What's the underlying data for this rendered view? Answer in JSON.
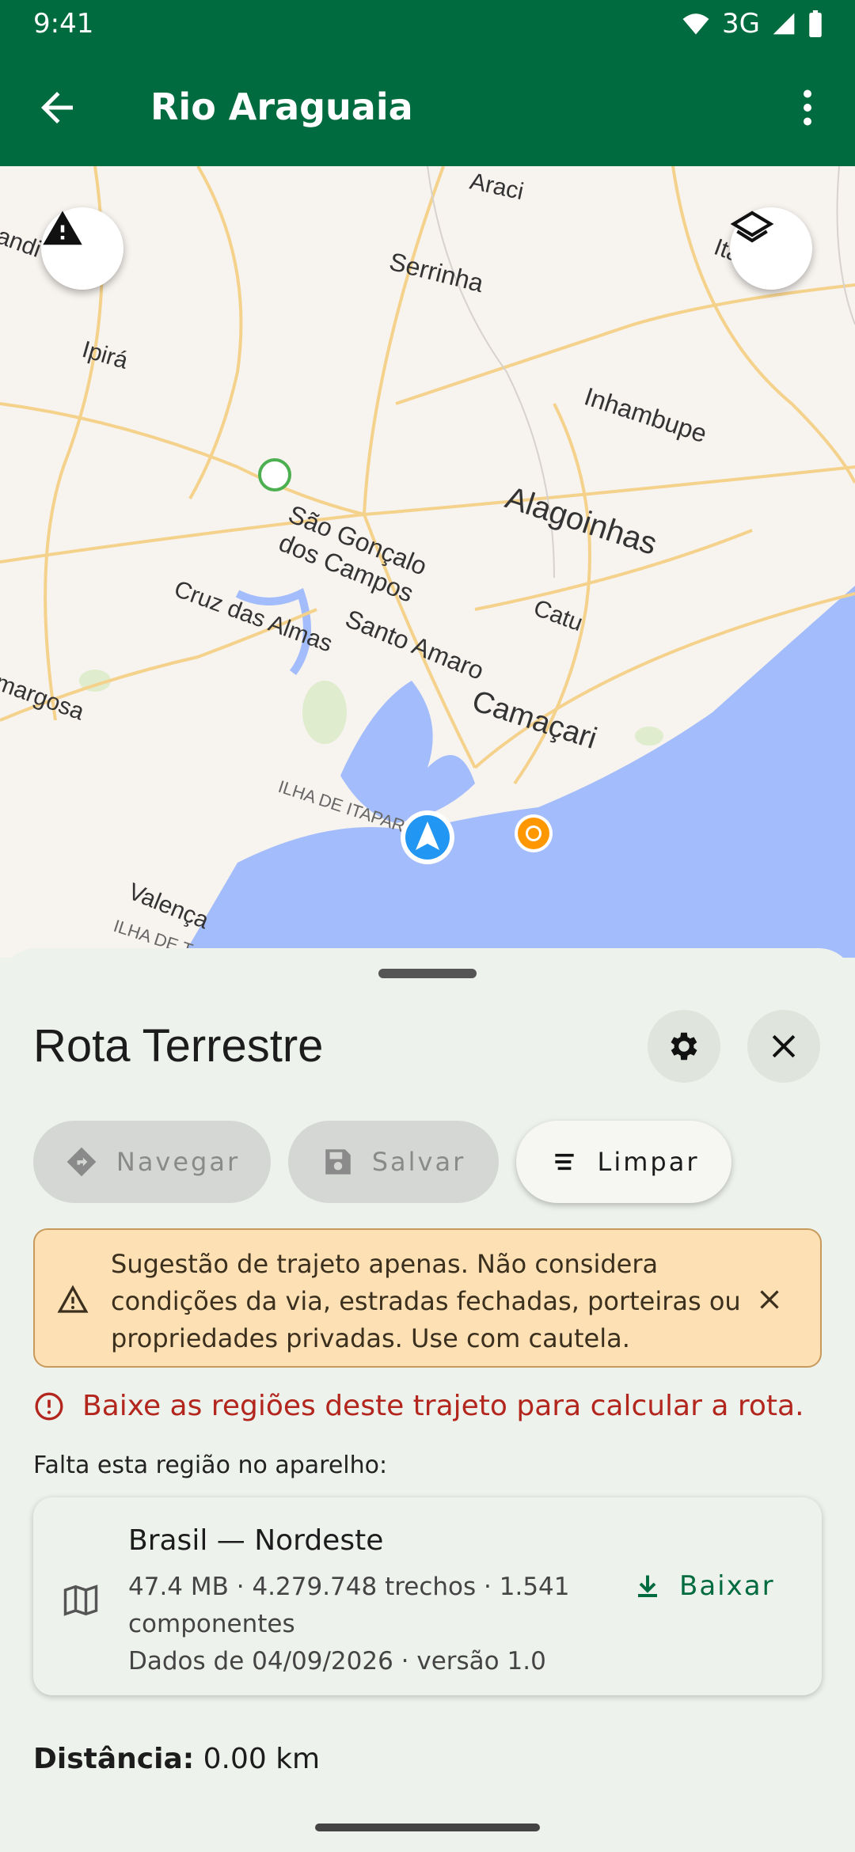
{
  "status_bar": {
    "time": "9:41",
    "network": "3G"
  },
  "app_bar": {
    "title": "Rio Araguaia"
  },
  "map": {
    "labels": [
      "Araci",
      "Serrinha",
      "Ipirá",
      "Inhambupe",
      "Alagoinhas",
      "São Gonçalo",
      "dos Campos",
      "Cruz das Almas",
      "Santo Amaro",
      "Catu",
      "Camaçari",
      "Valença",
      "ILHA DE ITAPARICA",
      "ILHA DE T",
      "margosa",
      "Itá",
      "andi"
    ]
  },
  "sheet": {
    "title": "Rota Terrestre",
    "buttons": {
      "navigate": "Navegar",
      "save": "Salvar",
      "clear": "Limpar"
    },
    "warning": "Sugestão de trajeto apenas. Não considera condições da via, estradas fechadas, porteiras ou propriedades privadas. Use com cautela.",
    "error": "Baixe as regiões deste trajeto para calcular a rota.",
    "missing_label": "Falta esta região no aparelho:",
    "region": {
      "name": "Brasil — Nordeste",
      "meta_line1": "47.4 MB · 4.279.748 trechos · 1.541 componentes",
      "meta_line2": "Dados de 04/09/2026 · versão 1.0",
      "download_label": "Baixar"
    },
    "distance_label": "Distância:",
    "distance_value": "0.00 km"
  },
  "colors": {
    "primary": "#006b3e",
    "error": "#b3261e",
    "warning_bg": "#fde0b3",
    "water": "#a3bcfb"
  }
}
